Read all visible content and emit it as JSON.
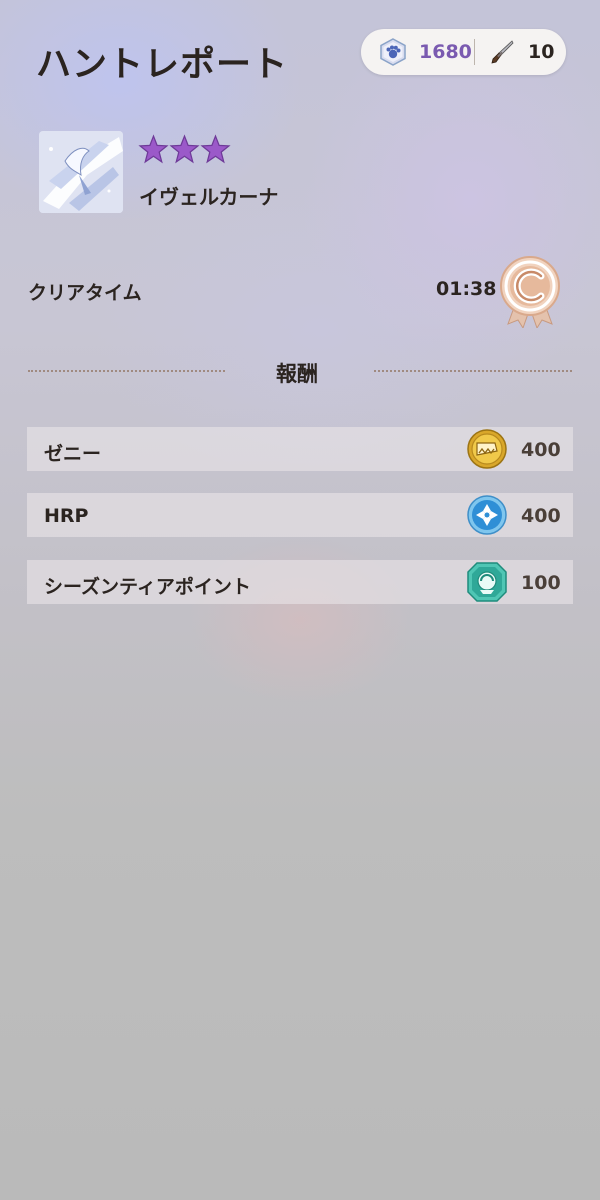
{
  "header": {
    "title": "ハントレポート"
  },
  "currency": [
    {
      "icon": "paw-gem-icon",
      "value": "1680",
      "color": "#7a5ab0"
    },
    {
      "icon": "knife-icon",
      "value": "10",
      "color": "#2b2420"
    }
  ],
  "monster": {
    "name": "イヴェルカーナ",
    "stars": 3,
    "star_color": "#9b59c9",
    "portrait_icon": "ice-dragon-portrait-icon"
  },
  "clear": {
    "label": "クリアタイム",
    "time": "01:38",
    "medal_icon": "bronze-c-rank-medal-icon"
  },
  "rewards": {
    "title": "報酬",
    "items": [
      {
        "label": "ゼニー",
        "value": "400",
        "icon": "zenny-coin-icon"
      },
      {
        "label": "HRP",
        "value": "400",
        "icon": "hrp-orb-icon"
      },
      {
        "label": "シーズンティアポイント",
        "value": "100",
        "icon": "season-tier-gem-icon"
      }
    ]
  }
}
